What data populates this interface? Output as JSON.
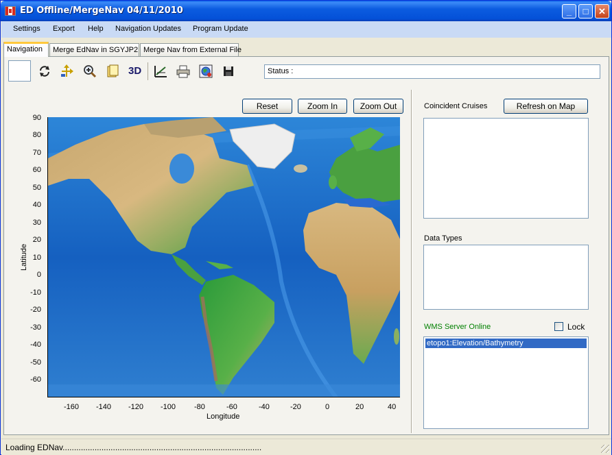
{
  "window": {
    "title": "ED Offline/MergeNav 04/11/2010"
  },
  "menu": [
    "Settings",
    "Export",
    "Help",
    "Navigation Updates",
    "Program Update"
  ],
  "tabs": [
    "Navigation",
    "Merge EdNav in SGYJP2",
    "Merge Nav from External File"
  ],
  "toolbar": {
    "tools": [
      "refresh-icon",
      "pan-icon",
      "zoom-icon",
      "layers-icon",
      "3d-icon",
      "measure-icon",
      "print-icon",
      "globe-icon",
      "save-icon"
    ],
    "label_3d": "3D",
    "status_label": "Status :"
  },
  "map": {
    "buttons": {
      "reset": "Reset",
      "zoom_in": "Zoom In",
      "zoom_out": "Zoom Out"
    },
    "y_ticks": [
      "90",
      "80",
      "70",
      "60",
      "50",
      "40",
      "30",
      "20",
      "10",
      "0",
      "-10",
      "-20",
      "-30",
      "-40",
      "-50",
      "-60"
    ],
    "x_ticks": [
      "-160",
      "-140",
      "-120",
      "-100",
      "-80",
      "-60",
      "-40",
      "-20",
      "0",
      "20",
      "40"
    ],
    "y_label": "Latitude",
    "x_label": "Longitude"
  },
  "right_panel": {
    "coincident_cruises_label": "Coincident Cruises",
    "refresh_button": "Refresh on Map",
    "data_types_label": "Data Types",
    "wms_label": "WMS Server Online",
    "lock_label": "Lock",
    "wms_layers": [
      "etopo1:Elevation/Bathymetry"
    ]
  },
  "statusbar": {
    "text": "Loading EDNav......................................................................................."
  },
  "colors": {
    "wms_label": "#008000",
    "selection": "#316ac5",
    "titlebar": "#0451d8"
  }
}
